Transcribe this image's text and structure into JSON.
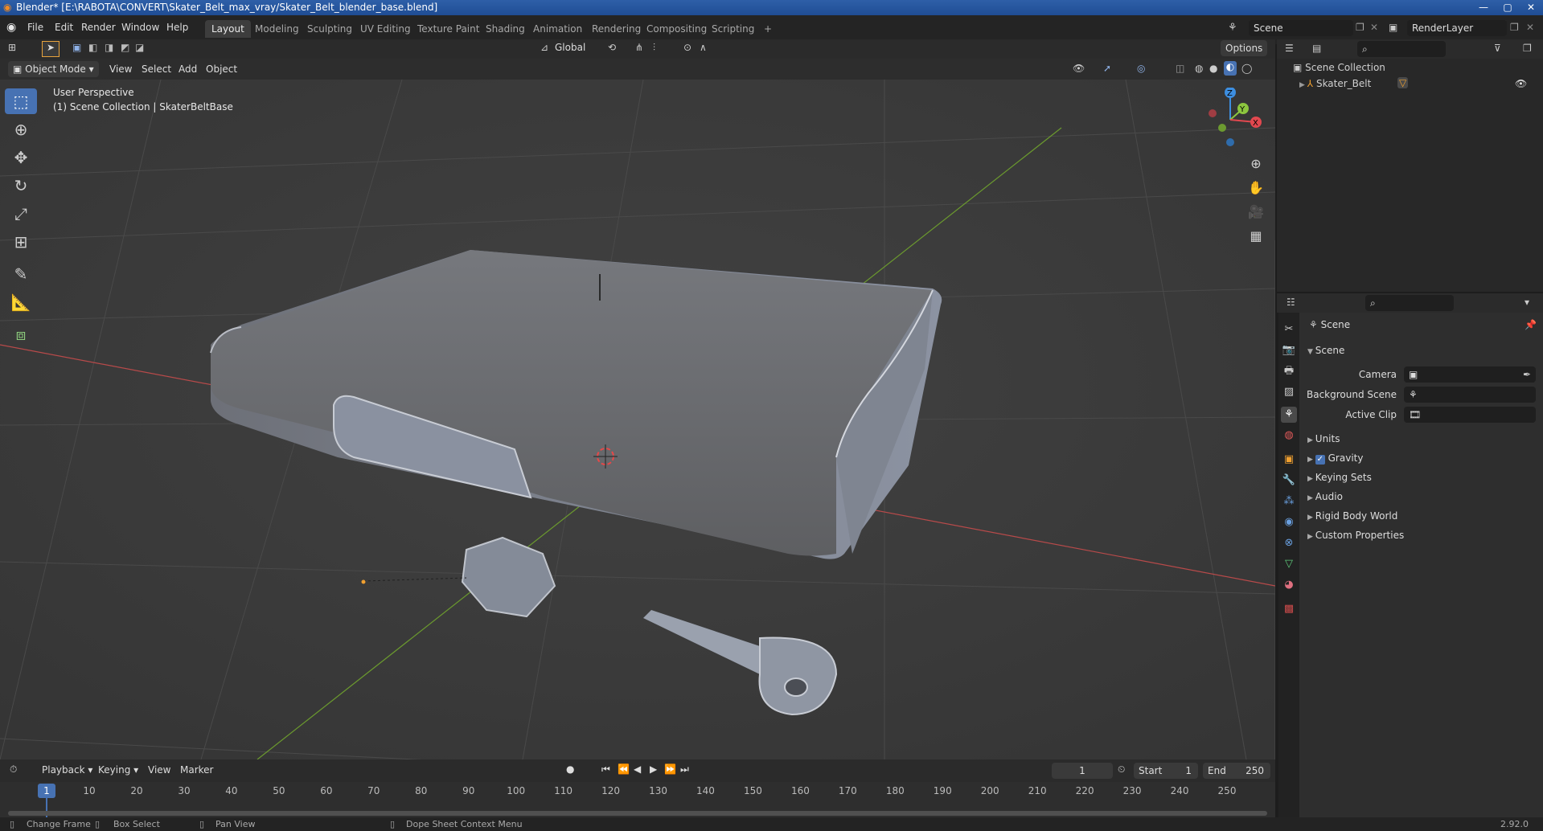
{
  "window": {
    "title": "Blender* [E:\\RABOTA\\CONVERT\\Skater_Belt_max_vray/Skater_Belt_blender_base.blend]",
    "minimize": "—",
    "maximize": "▢",
    "close": "✕"
  },
  "menu": [
    "File",
    "Edit",
    "Render",
    "Window",
    "Help"
  ],
  "workspaces": [
    "Layout",
    "Modeling",
    "Sculpting",
    "UV Editing",
    "Texture Paint",
    "Shading",
    "Animation",
    "Rendering",
    "Compositing",
    "Scripting"
  ],
  "add_workspace": "+",
  "scene_field": "Scene",
  "renderlayer_field": "RenderLayer",
  "toolbar": {
    "transform_orientation": "Global",
    "options": "Options"
  },
  "viewport_header": {
    "mode": "Object Mode",
    "view": "View",
    "select": "Select",
    "add": "Add",
    "object": "Object"
  },
  "viewport": {
    "perspective_label": "User Perspective",
    "collection_label": "(1) Scene Collection | SkaterBeltBase",
    "gizmo": {
      "x": "X",
      "y": "Y",
      "z": "Z"
    }
  },
  "outliner": {
    "root": "Scene Collection",
    "items": [
      {
        "label": "Skater_Belt"
      }
    ]
  },
  "properties": {
    "header_title": "Scene",
    "section": "Scene",
    "camera_label": "Camera",
    "background_label": "Background Scene",
    "clip_label": "Active Clip",
    "panels": [
      "Units",
      "Gravity",
      "Keying Sets",
      "Audio",
      "Rigid Body World",
      "Custom Properties"
    ],
    "gravity_checked": true
  },
  "timeline": {
    "playback": "Playback",
    "keying": "Keying",
    "view": "View",
    "marker": "Marker",
    "current_frame": "1",
    "start_label": "Start",
    "start": "1",
    "end_label": "End",
    "end": "250",
    "ticks": [
      "1",
      "10",
      "20",
      "30",
      "40",
      "50",
      "60",
      "70",
      "80",
      "90",
      "100",
      "110",
      "120",
      "130",
      "140",
      "150",
      "160",
      "170",
      "180",
      "190",
      "200",
      "210",
      "220",
      "230",
      "240",
      "250"
    ]
  },
  "status": {
    "change_frame": "Change Frame",
    "box_select": "Box Select",
    "pan_view": "Pan View",
    "context_menu": "Dope Sheet Context Menu",
    "version": "2.92.0"
  },
  "colors": {
    "accent": "#4772b3",
    "x_axis": "#e2484f",
    "y_axis": "#8cc63f",
    "z_axis": "#3d8ee0",
    "active_tab": "#3d3d3d"
  }
}
